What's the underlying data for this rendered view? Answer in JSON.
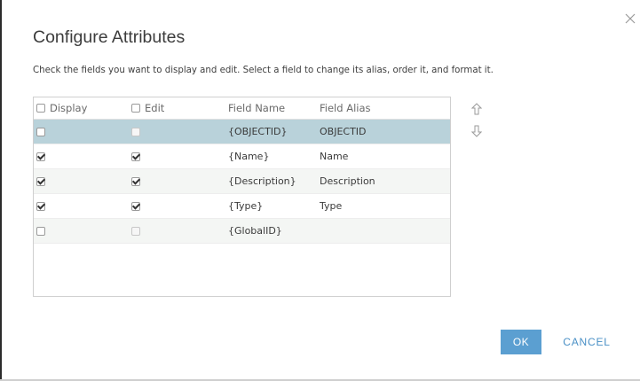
{
  "dialog": {
    "title": "Configure Attributes",
    "instructions": "Check the fields you want to display and edit. Select a field to change its alias, order it, and format it.",
    "close_icon": "close-icon"
  },
  "table": {
    "headers": {
      "display": "Display",
      "edit": "Edit",
      "field_name": "Field Name",
      "field_alias": "Field Alias"
    },
    "header_checks": {
      "display": false,
      "edit": false
    },
    "rows": [
      {
        "field_name": "{OBJECTID}",
        "field_alias": "OBJECTID",
        "display": false,
        "edit": false,
        "edit_enabled": false,
        "selected": true
      },
      {
        "field_name": "{Name}",
        "field_alias": "Name",
        "display": true,
        "edit": true,
        "edit_enabled": true,
        "selected": false
      },
      {
        "field_name": "{Description}",
        "field_alias": "Description",
        "display": true,
        "edit": true,
        "edit_enabled": true,
        "selected": false
      },
      {
        "field_name": "{Type}",
        "field_alias": "Type",
        "display": true,
        "edit": true,
        "edit_enabled": true,
        "selected": false
      },
      {
        "field_name": "{GlobalID}",
        "field_alias": "",
        "display": false,
        "edit": false,
        "edit_enabled": false,
        "selected": false
      }
    ]
  },
  "order_controls": {
    "up_icon": "arrow-up-icon",
    "down_icon": "arrow-down-icon"
  },
  "footer": {
    "ok_label": "OK",
    "cancel_label": "CANCEL"
  },
  "colors": {
    "accent": "#5b9fd1",
    "link": "#4a90c6",
    "selected_row": "#b9d2da",
    "alt_row": "#f4f6f4"
  }
}
